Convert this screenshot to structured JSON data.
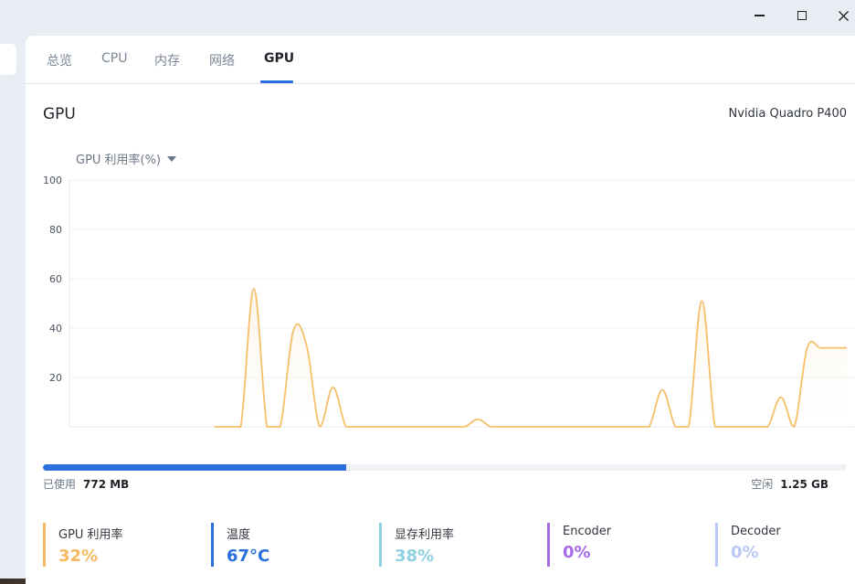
{
  "tabs": [
    {
      "label": "总览",
      "active": false
    },
    {
      "label": "CPU",
      "active": false
    },
    {
      "label": "内存",
      "active": false
    },
    {
      "label": "网络",
      "active": false
    },
    {
      "label": "GPU",
      "active": true
    }
  ],
  "section": {
    "title": "GPU",
    "device": "Nvidia Quadro P400"
  },
  "metric_select": {
    "label": "GPU 利用率(%)"
  },
  "chart_data": {
    "type": "area",
    "ylim": [
      0,
      100
    ],
    "yticks": [
      100,
      80,
      60,
      40,
      20
    ],
    "grid": true,
    "color": "#f5c06a",
    "fill_color": "#fdf2e2",
    "x": [
      0,
      1,
      2,
      3,
      4,
      5,
      6,
      7,
      8,
      9,
      10,
      11,
      12,
      13,
      14,
      15,
      16,
      17,
      18,
      19,
      20,
      21,
      22,
      23,
      24,
      25,
      26,
      27,
      28,
      29,
      30,
      31,
      32,
      33,
      34,
      35,
      36,
      37,
      38,
      39,
      40,
      41,
      42,
      43,
      44,
      45,
      46,
      47,
      48,
      49,
      50,
      51,
      52,
      53,
      54,
      55,
      56,
      57,
      58,
      59
    ],
    "values": [
      0,
      0,
      0,
      0,
      0,
      0,
      0,
      0,
      0,
      0,
      0,
      0,
      0,
      0,
      56,
      0,
      0,
      39,
      33,
      0,
      16,
      0,
      0,
      0,
      0,
      0,
      0,
      0,
      0,
      0,
      0,
      3,
      0,
      0,
      0,
      0,
      0,
      0,
      0,
      0,
      0,
      0,
      0,
      0,
      0,
      15,
      0,
      0,
      51,
      0,
      0,
      0,
      0,
      0,
      12,
      0,
      32,
      32,
      32,
      32
    ],
    "start_index": 11,
    "end_index": 56
  },
  "memory": {
    "used_label": "已使用",
    "used_value": "772 MB",
    "free_label": "空闲",
    "free_value": "1.25 GB",
    "used_fraction": 0.377
  },
  "stats": [
    {
      "label": "GPU 利用率",
      "value": "32%",
      "color": "#f5b95f"
    },
    {
      "label": "温度",
      "value": "67°C",
      "color": "#2a6fdb"
    },
    {
      "label": "显存利用率",
      "value": "38%",
      "color": "#8fd0e0"
    },
    {
      "label": "Encoder",
      "value": "0%",
      "color": "#a86be8"
    },
    {
      "label": "Decoder",
      "value": "0%",
      "color": "#b9c8f5"
    }
  ]
}
